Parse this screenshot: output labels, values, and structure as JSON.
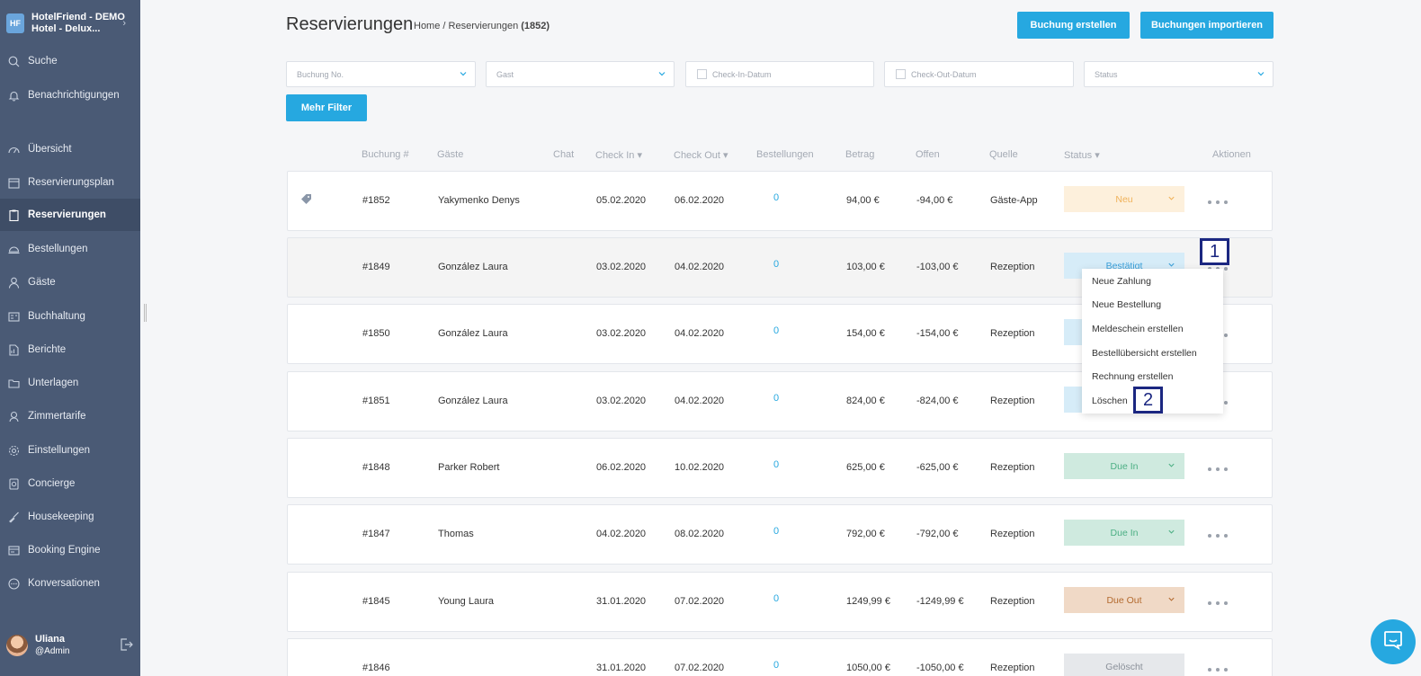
{
  "sidebar": {
    "hotel": "HotelFriend - DEMO Hotel - Delux...",
    "search": "Suche",
    "notifications": "Benachrichtigungen",
    "items": [
      {
        "label": "Übersicht",
        "icon": "dashboard-icon"
      },
      {
        "label": "Reservierungsplan",
        "icon": "calendar-icon"
      },
      {
        "label": "Reservierungen",
        "icon": "reservations-icon",
        "active": true
      },
      {
        "label": "Bestellungen",
        "icon": "cloche-icon"
      },
      {
        "label": "Gäste",
        "icon": "user-icon"
      },
      {
        "label": "Buchhaltung",
        "icon": "ledger-icon"
      },
      {
        "label": "Berichte",
        "icon": "report-icon"
      },
      {
        "label": "Unterlagen",
        "icon": "folder-icon"
      },
      {
        "label": "Zimmertarife",
        "icon": "rate-icon"
      },
      {
        "label": "Einstellungen",
        "icon": "gear-icon"
      },
      {
        "label": "Concierge",
        "icon": "concierge-icon"
      },
      {
        "label": "Housekeeping",
        "icon": "broom-icon"
      },
      {
        "label": "Booking Engine",
        "icon": "booking-icon"
      },
      {
        "label": "Konversationen",
        "icon": "chat-icon"
      }
    ],
    "user": {
      "name": "Uliana",
      "role": "@Admin"
    }
  },
  "header": {
    "title": "Reservierungen",
    "breadcrumb_home": "Home",
    "breadcrumb_sep": "/",
    "breadcrumb_current": "Reservierungen",
    "breadcrumb_count": "(1852)",
    "create_button": "Buchung erstellen",
    "import_button": "Buchungen importieren"
  },
  "filters": {
    "booking_no": "Buchung No.",
    "guest": "Gast",
    "check_in": "Check-In-Datum",
    "check_out": "Check-Out-Datum",
    "status": "Status",
    "more": "Mehr Filter"
  },
  "table": {
    "headers": {
      "booking": "Buchung #",
      "guests": "Gäste",
      "chat": "Chat",
      "checkin": "Check In",
      "checkout": "Check Out",
      "orders": "Bestellungen",
      "amount": "Betrag",
      "open": "Offen",
      "source": "Quelle",
      "status": "Status",
      "actions": "Aktionen"
    },
    "rows": [
      {
        "id": "#1852",
        "guest": "Yakymenko Denys",
        "checkin": "05.02.2020",
        "checkout": "06.02.2020",
        "orders": "0",
        "amount": "94,00 €",
        "open": "-94,00 €",
        "source": "Gäste-App",
        "status": "Neu",
        "status_bg": "#fdf0dc",
        "status_fg": "#f0b25a",
        "tag": true
      },
      {
        "id": "#1849",
        "guest": "González Laura",
        "checkin": "03.02.2020",
        "checkout": "04.02.2020",
        "orders": "0",
        "amount": "103,00 €",
        "open": "-103,00 €",
        "source": "Rezeption",
        "status": "Bestätigt",
        "status_bg": "#d6ecf8",
        "status_fg": "#3a9fd8"
      },
      {
        "id": "#1850",
        "guest": "González Laura",
        "checkin": "03.02.2020",
        "checkout": "04.02.2020",
        "orders": "0",
        "amount": "154,00 €",
        "open": "-154,00 €",
        "source": "Rezeption",
        "status": "",
        "status_bg": "#d6ecf8",
        "status_fg": "#3a9fd8"
      },
      {
        "id": "#1851",
        "guest": "González Laura",
        "checkin": "03.02.2020",
        "checkout": "04.02.2020",
        "orders": "0",
        "amount": "824,00 €",
        "open": "-824,00 €",
        "source": "Rezeption",
        "status": "",
        "status_bg": "#d6ecf8",
        "status_fg": "#3a9fd8"
      },
      {
        "id": "#1848",
        "guest": "Parker Robert",
        "checkin": "06.02.2020",
        "checkout": "10.02.2020",
        "orders": "0",
        "amount": "625,00 €",
        "open": "-625,00 €",
        "source": "Rezeption",
        "status": "Due In",
        "status_bg": "#cfeadf",
        "status_fg": "#4caf84"
      },
      {
        "id": "#1847",
        "guest": "Thomas",
        "checkin": "04.02.2020",
        "checkout": "08.02.2020",
        "orders": "0",
        "amount": "792,00 €",
        "open": "-792,00 €",
        "source": "Rezeption",
        "status": "Due In",
        "status_bg": "#cfeadf",
        "status_fg": "#4caf84"
      },
      {
        "id": "#1845",
        "guest": "Young Laura",
        "checkin": "31.01.2020",
        "checkout": "07.02.2020",
        "orders": "0",
        "amount": "1249,99 €",
        "open": "-1249,99 €",
        "source": "Rezeption",
        "status": "Due Out",
        "status_bg": "#f0d9c6",
        "status_fg": "#b36a2f"
      },
      {
        "id": "#1846",
        "guest": "",
        "checkin": "31.01.2020",
        "checkout": "07.02.2020",
        "orders": "0",
        "amount": "1050,00 €",
        "open": "-1050,00 €",
        "source": "Rezeption",
        "status": "Gelöscht",
        "status_bg": "#e6e8eb",
        "status_fg": "#8a9099"
      }
    ]
  },
  "menu": {
    "items": [
      "Neue Zahlung",
      "Neue Bestellung",
      "Meldeschein erstellen",
      "Bestellübersicht erstellen",
      "Rechnung erstellen",
      "Löschen"
    ]
  },
  "callouts": [
    "1",
    "2"
  ]
}
